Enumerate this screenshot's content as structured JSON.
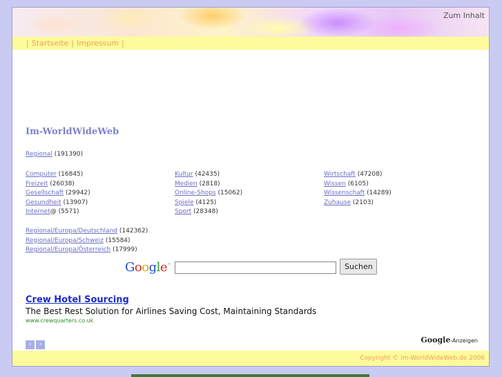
{
  "header": {
    "skip_link": "Zum Inhalt"
  },
  "nav": {
    "items": [
      "Startseite",
      "Impressum"
    ]
  },
  "site_title": "Im-WorldWideWeb",
  "regional": {
    "label": "Regional",
    "count": "(191390)"
  },
  "categories": {
    "col1": [
      {
        "label": "Computer",
        "count": "(16845)"
      },
      {
        "label": "Freizeit",
        "count": "(26038)"
      },
      {
        "label": "Gesellschaft",
        "count": "(29942)"
      },
      {
        "label": "Gesundheit",
        "count": "(13907)"
      },
      {
        "label": "Internet",
        "suffix": "@",
        "count": "(5571)"
      }
    ],
    "col2": [
      {
        "label": "Kultur",
        "count": "(42435)"
      },
      {
        "label": "Medien",
        "count": "(2818)"
      },
      {
        "label": "Online-Shops",
        "count": "(15062)"
      },
      {
        "label": "Spiele",
        "count": "(4125)"
      },
      {
        "label": "Sport",
        "count": "(28348)"
      }
    ],
    "col3": [
      {
        "label": "Wirtschaft",
        "count": "(47208)"
      },
      {
        "label": "Wissen",
        "count": "(6105)"
      },
      {
        "label": "Wissenschaft",
        "count": "(14289)"
      },
      {
        "label": "Zuhause",
        "count": "(2103)"
      }
    ]
  },
  "subregions": [
    {
      "label": "Regional/Europa/Deutschland",
      "count": "(142362)"
    },
    {
      "label": "Regional/Europa/Schweiz",
      "count": "(15584)"
    },
    {
      "label": "Regional/Europa/Österreich",
      "count": "(17999)"
    }
  ],
  "search": {
    "logo": "Google",
    "logo_tm": "™",
    "value": "",
    "button": "Suchen"
  },
  "ad": {
    "title": "Crew Hotel Sourcing",
    "text": "The Best Rest Solution for Airlines Saving Cost, Maintaining Standards",
    "url": "www.crewquarters.co.uk",
    "prev_icon": "‹",
    "next_icon": "›"
  },
  "ads_label": {
    "brand": "Google",
    "text": "-Anzeigen"
  },
  "footer": {
    "copyright": "Copyright © im-WorldWideWeb.de 2006"
  }
}
